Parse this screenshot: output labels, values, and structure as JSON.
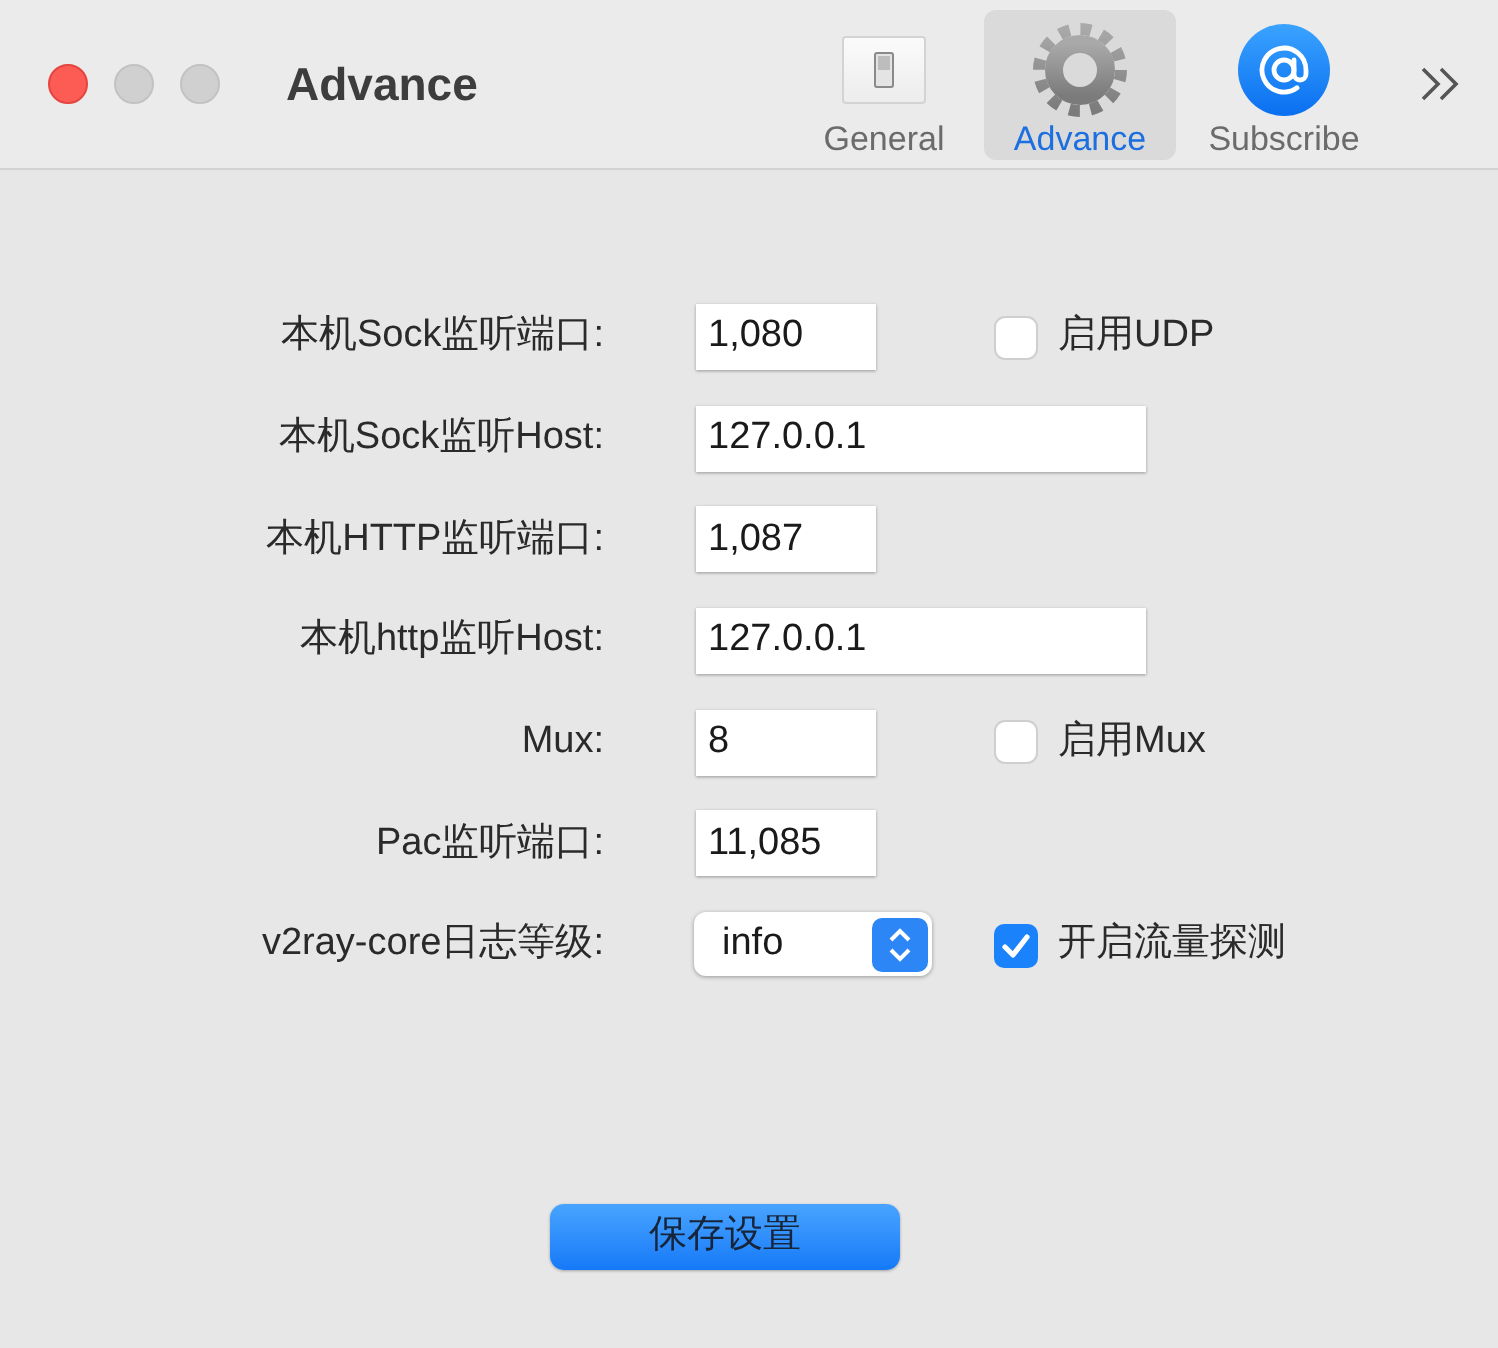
{
  "window": {
    "title": "Advance"
  },
  "toolbar": {
    "tabs": [
      {
        "label": "General",
        "kind": "switch",
        "selected": false
      },
      {
        "label": "Advance",
        "kind": "gear",
        "selected": true
      },
      {
        "label": "Subscribe",
        "kind": "at",
        "selected": false
      }
    ]
  },
  "form": {
    "rows": [
      {
        "label": "本机Sock监听端口:",
        "kind": "number",
        "value": "1,080",
        "option": {
          "label": "启用UDP",
          "checked": false
        }
      },
      {
        "label": "本机Sock监听Host:",
        "kind": "text",
        "value": "127.0.0.1"
      },
      {
        "label": "本机HTTP监听端口:",
        "kind": "number",
        "value": "1,087"
      },
      {
        "label": "本机http监听Host:",
        "kind": "text",
        "value": "127.0.0.1"
      },
      {
        "label": "Mux:",
        "kind": "number",
        "value": "8",
        "option": {
          "label": "启用Mux",
          "checked": false
        }
      },
      {
        "label": "Pac监听端口:",
        "kind": "number",
        "value": "11,085"
      },
      {
        "label": "v2ray-core日志等级:",
        "kind": "popup",
        "value": "info",
        "option": {
          "label": "开启流量探测",
          "checked": true
        }
      }
    ]
  },
  "save_button": {
    "label": "保存设置"
  }
}
